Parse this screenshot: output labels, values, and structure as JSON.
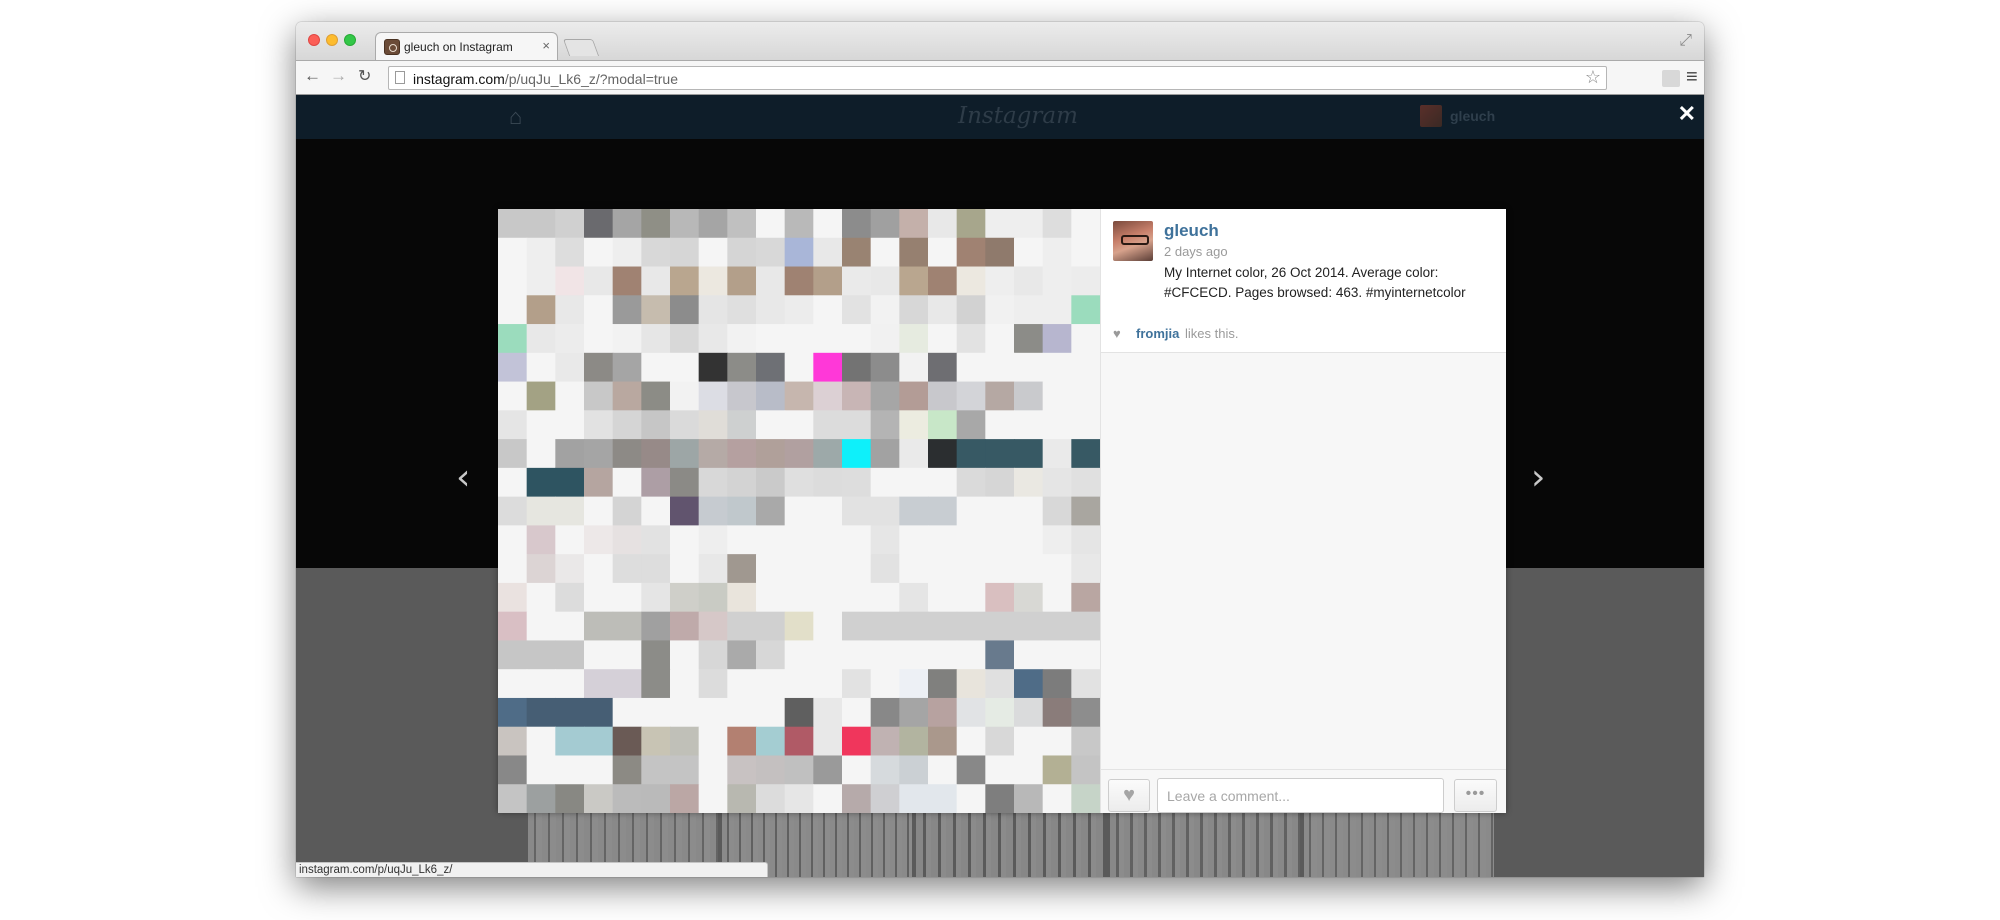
{
  "browser": {
    "tab_title": "gleuch on Instagram",
    "tab_close": "×",
    "url_host": "instagram.com",
    "url_path": "/p/uqJu_Lk6_z/?modal=true",
    "status_url": "instagram.com/p/uqJu_Lk6_z/"
  },
  "header": {
    "logo": "Instagram",
    "username": "gleuch",
    "close_label": "✕"
  },
  "navigation": {
    "prev_label": "‹",
    "next_label": "›"
  },
  "post": {
    "username": "gleuch",
    "timestamp": "2 days ago",
    "caption": "My Internet color, 26 Oct 2014. Average color: #CFCECD. Pages browsed: 463. #myinternetcolor",
    "average_color": "#CFCECD",
    "likes": {
      "user": "fromjia",
      "suffix": "likes this."
    }
  },
  "comment": {
    "placeholder": "Leave a comment...",
    "more_label": "•••"
  },
  "colors": {
    "accent_blue": "#3f729b",
    "header_bg": "#0e1d29",
    "modal_bg": "#f7f7f7"
  },
  "mosaic": {
    "cols": 21,
    "rows": 21,
    "cells": [
      "#c8c8c8",
      "#c8c8c8",
      "#d0d0d0",
      "#6a6a6e",
      "#a5a5a5",
      "#8f8f86",
      "#b8b8b8",
      "#a5a5a5",
      "#c0c0c0",
      "#f5f5f5",
      "#b9b9b9",
      "#f5f5f5",
      "#8c8c8c",
      "#a0a0a0",
      "#c4b0aa",
      "#e8e8e8",
      "#a7a68c",
      "#eeeeee",
      "#eeeeee",
      "#dddddd",
      "#f5f5f5",
      "#f5f5f5",
      "#eeeeee",
      "#dddddd",
      "#f5f5f5",
      "#eeeeee",
      "#d8d8d8",
      "#d6d6d6",
      "#f5f5f5",
      "#d5d5d5",
      "#d8d8d8",
      "#a9b6d8",
      "#e8e8e8",
      "#998372",
      "#f5f5f5",
      "#968070",
      "#f5f5f5",
      "#a08272",
      "#8f7a6c",
      "#f5f5f5",
      "#eeeeee",
      "#f5f5f5",
      "#f5f5f5",
      "#eeeeee",
      "#f1e4e6",
      "#e8e8e8",
      "#a08272",
      "#e8e8e8",
      "#b9a68f",
      "#ece8e0",
      "#b39f8a",
      "#e8e8e8",
      "#9f8272",
      "#b39f8a",
      "#eaeaea",
      "#e8e8e8",
      "#b9a68f",
      "#9f8272",
      "#ece8e0",
      "#eeeeee",
      "#e8e8e8",
      "#eeeeee",
      "#ececec",
      "#f5f5f5",
      "#b39f8a",
      "#e8e8e8",
      "#f5f5f5",
      "#9a9a9a",
      "#c6bcae",
      "#8c8c8c",
      "#e5e5e5",
      "#dfdfdf",
      "#e8e8e8",
      "#ececec",
      "#f5f5f5",
      "#e2e2e2",
      "#f2f2f2",
      "#d7d7d7",
      "#e8e8e8",
      "#d2d2d2",
      "#f1f1f1",
      "#eeeeee",
      "#eeeeee",
      "#9bdcbd",
      "#9bdcbd",
      "#e8e8e8",
      "#ececec",
      "#f5f5f5",
      "#f2f2f2",
      "#e6e6e6",
      "#d8d8d8",
      "#e8e8e8",
      "#f2f2f2",
      "#f5f5f5",
      "#f5f5f5",
      "#f5f5f5",
      "#f5f5f5",
      "#f1f1f1",
      "#e6ebe0",
      "#f5f5f5",
      "#e2e2e2",
      "#f5f5f5",
      "#8c8c88",
      "#b7b6cf",
      "#f5f5f5",
      "#c2c3d8",
      "#f5f5f5",
      "#e9e9e9",
      "#8c8a86",
      "#a5a5a5",
      "#f5f5f5",
      "#f5f5f5",
      "#333333",
      "#8c8c88",
      "#6e7075",
      "#f5f5f5",
      "#ff38d8",
      "#737373",
      "#8c8c8c",
      "#f2f2f2",
      "#6e6e72",
      "#f5f5f5",
      "#f5f5f5",
      "#f5f5f5",
      "#f5f5f5",
      "#f5f5f5",
      "#f5f5f5",
      "#a3a284",
      "#f5f5f5",
      "#c8c8c8",
      "#b9a8a0",
      "#8c8c86",
      "#f2f2f2",
      "#dcdde4",
      "#c7c7cd",
      "#b8bcc8",
      "#c6b6ae",
      "#dcd0d4",
      "#c8b5b5",
      "#a6a6a6",
      "#b39c96",
      "#c8c8cc",
      "#d3d4d8",
      "#b5a8a3",
      "#c9cacd",
      "#f5f5f5",
      "#f5f5f5",
      "#e5e5e5",
      "#f5f5f5",
      "#f5f5f5",
      "#e2e2e2",
      "#d5d5d5",
      "#c6c6c6",
      "#dadada",
      "#e0ddd8",
      "#ced0d0",
      "#f5f5f5",
      "#f5f5f5",
      "#dcdcdc",
      "#dcdcdc",
      "#b4b4b4",
      "#ecece0",
      "#c8e7c8",
      "#a8a8a8",
      "#f5f5f5",
      "#f5f5f5",
      "#f5f5f5",
      "#f5f5f5",
      "#c8c8c8",
      "#f5f5f5",
      "#a2a2a2",
      "#a5a5a5",
      "#8d8a86",
      "#978a88",
      "#9da6a6",
      "#b5aaa6",
      "#b5a0a0",
      "#b0a09a",
      "#b1a0a0",
      "#9da9a9",
      "#0ef0fa",
      "#a2a2a2",
      "#eaeaea",
      "#2b2e30",
      "#375964",
      "#375964",
      "#375964",
      "#eaeaea",
      "#375964",
      "#f5f5f5",
      "#2e5461",
      "#2e5461",
      "#b5a5a0",
      "#f5f5f5",
      "#ad9ea5",
      "#8b8a86",
      "#d8d8d8",
      "#d3d3d3",
      "#cacaca",
      "#dfdfdf",
      "#dcdcdc",
      "#dddddd",
      "#f5f5f5",
      "#f5f5f5",
      "#f5f5f5",
      "#dadada",
      "#d6d6d6",
      "#eae8e2",
      "#e5e5e5",
      "#e0e0e0",
      "#dcdcdc",
      "#e6e6e0",
      "#e6e6e0",
      "#f5f5f5",
      "#d4d4d4",
      "#f5f5f5",
      "#61546e",
      "#c6cbd0",
      "#c0c8cc",
      "#a9a9a9",
      "#f5f5f5",
      "#f5f5f5",
      "#e2e2e2",
      "#e2e2e2",
      "#c8cdd2",
      "#c8cdd2",
      "#f5f5f5",
      "#f5f5f5",
      "#f5f5f5",
      "#d8d8d8",
      "#a9a6a0",
      "#f5f5f5",
      "#d8c8cc",
      "#f5f5f5",
      "#ede8e8",
      "#e6e1e1",
      "#e2e2e2",
      "#f5f5f5",
      "#eeeeee",
      "#f5f5f5",
      "#f5f5f5",
      "#f5f5f5",
      "#f5f5f5",
      "#f5f5f5",
      "#e6e6e6",
      "#f5f5f5",
      "#f5f5f5",
      "#f5f5f5",
      "#f5f5f5",
      "#f5f5f5",
      "#eeeeee",
      "#e5e5e5",
      "#f5f5f5",
      "#dcd4d4",
      "#eae8e8",
      "#f5f5f5",
      "#dddddd",
      "#dddddd",
      "#f5f5f5",
      "#e8e8e8",
      "#a09890",
      "#f5f5f5",
      "#f5f5f5",
      "#f5f5f5",
      "#f5f5f5",
      "#e2e2e2",
      "#f5f5f5",
      "#f5f5f5",
      "#f5f5f5",
      "#f5f5f5",
      "#f5f5f5",
      "#f5f5f5",
      "#e8e8e8",
      "#eae2e0",
      "#f5f5f5",
      "#dcdcdc",
      "#f5f5f5",
      "#f5f5f5",
      "#e5e5e5",
      "#cfcfc9",
      "#c9cbc4",
      "#e9e4dc",
      "#f5f5f5",
      "#f5f5f5",
      "#f5f5f5",
      "#f5f5f5",
      "#f5f5f5",
      "#e5e5e5",
      "#f5f5f5",
      "#f5f5f5",
      "#d9bfc0",
      "#d8d8d4",
      "#f5f5f5",
      "#b9a6a2",
      "#d9bfc4",
      "#f5f5f5",
      "#f5f5f5",
      "#bdbdb8",
      "#bdbdb8",
      "#a0a0a0",
      "#bfaaaa",
      "#d6c8c8",
      "#d0d0d0",
      "#d0d0d0",
      "#e2dfc9",
      "#f5f5f5",
      "#d0d0d0",
      "#d0d0d0",
      "#d0d0d0",
      "#d0d0d0",
      "#d0d0d0",
      "#d0d0d0",
      "#d0d0d0",
      "#d0d0d0",
      "#d0d0d0",
      "#c6c6c6",
      "#c6c6c6",
      "#c6c6c6",
      "#f5f5f5",
      "#f5f5f5",
      "#8c8c88",
      "#f5f5f5",
      "#d7d7d7",
      "#aaaaaa",
      "#d7d7d7",
      "#f5f5f5",
      "#f5f5f5",
      "#f5f5f5",
      "#f5f5f5",
      "#f5f5f5",
      "#f5f5f5",
      "#f5f5f5",
      "#687a8d",
      "#f5f5f5",
      "#f5f5f5",
      "#f5f5f5",
      "#f5f5f5",
      "#f5f5f5",
      "#f5f5f5",
      "#d5d0d8",
      "#d5d0d8",
      "#8c8c88",
      "#f5f5f5",
      "#dcdcdc",
      "#f5f5f5",
      "#f5f5f5",
      "#f5f5f5",
      "#f5f5f5",
      "#e2e2e2",
      "#f5f5f5",
      "#edf0f5",
      "#80807e",
      "#e8e4dc",
      "#e0e0e0",
      "#4f6c87",
      "#7c7c7c",
      "#e2e2e2",
      "#4f6c87",
      "#465e74",
      "#465e74",
      "#465e74",
      "#f5f5f5",
      "#f5f5f5",
      "#f5f5f5",
      "#f5f5f5",
      "#f5f5f5",
      "#f5f5f5",
      "#5f5f5f",
      "#e8e8e8",
      "#f5f5f5",
      "#888888",
      "#a5a5a5",
      "#b7a2a0",
      "#e1e3e5",
      "#e5ebe4",
      "#dadbdc",
      "#8a7c7a",
      "#8d8d8d",
      "#c9c4c0",
      "#f5f5f5",
      "#a4cbd2",
      "#a4cbd2",
      "#6a5a55",
      "#c8c4b4",
      "#c0c0b8",
      "#f5f5f5",
      "#b38071",
      "#a4cdd2",
      "#b05a66",
      "#e8e8e8",
      "#f0365c",
      "#c0b2b2",
      "#b2b4a0",
      "#aa988c",
      "#f5f5f5",
      "#d8d8d8",
      "#f5f5f5",
      "#f5f5f5",
      "#c8c8c8",
      "#888888",
      "#f5f5f5",
      "#f5f5f5",
      "#f5f5f5",
      "#8c8a84",
      "#c4c4c4",
      "#c4c4c4",
      "#f5f5f5",
      "#c8c2c2",
      "#c4c0c0",
      "#c0c0c0",
      "#9a9a9a",
      "#f5f5f5",
      "#d6dadd",
      "#cbd0d4",
      "#f5f5f5",
      "#888888",
      "#f5f5f5",
      "#f5f5f5",
      "#b3b094",
      "#c4c4c4",
      "#c4c4c4",
      "#9ca0a0",
      "#888883",
      "#cac9c5",
      "#bbbbbb",
      "#bababa",
      "#bba7a5",
      "#f5f5f5",
      "#b8b8b0",
      "#dcdcdc",
      "#e6e6e6",
      "#f5f5f5",
      "#b6aaaa",
      "#cfcfd2",
      "#e2e7ec",
      "#e2e7ec",
      "#f5f5f5",
      "#7e7e7e",
      "#b8b8b8",
      "#f5f5f5",
      "#c6d4c8",
      "#2f2f2f",
      "#2f2f2f",
      "#f5f5f5",
      "#9d9d9d",
      "#f5f5f5",
      "#b8b8b8",
      "#dcdcdc",
      "#cac2c2",
      "#f5f5f5",
      "#e2e2e2",
      "#f5f5f5",
      "#888884",
      "#b5b5b5",
      "#f5f5f5",
      "#d2d2d2",
      "#f5f5f5",
      "#b3b3b3",
      "#f5f5f5",
      "#f5f5f5",
      "#b8b49a",
      "#f5f5f5",
      "#f5f5f5"
    ]
  }
}
